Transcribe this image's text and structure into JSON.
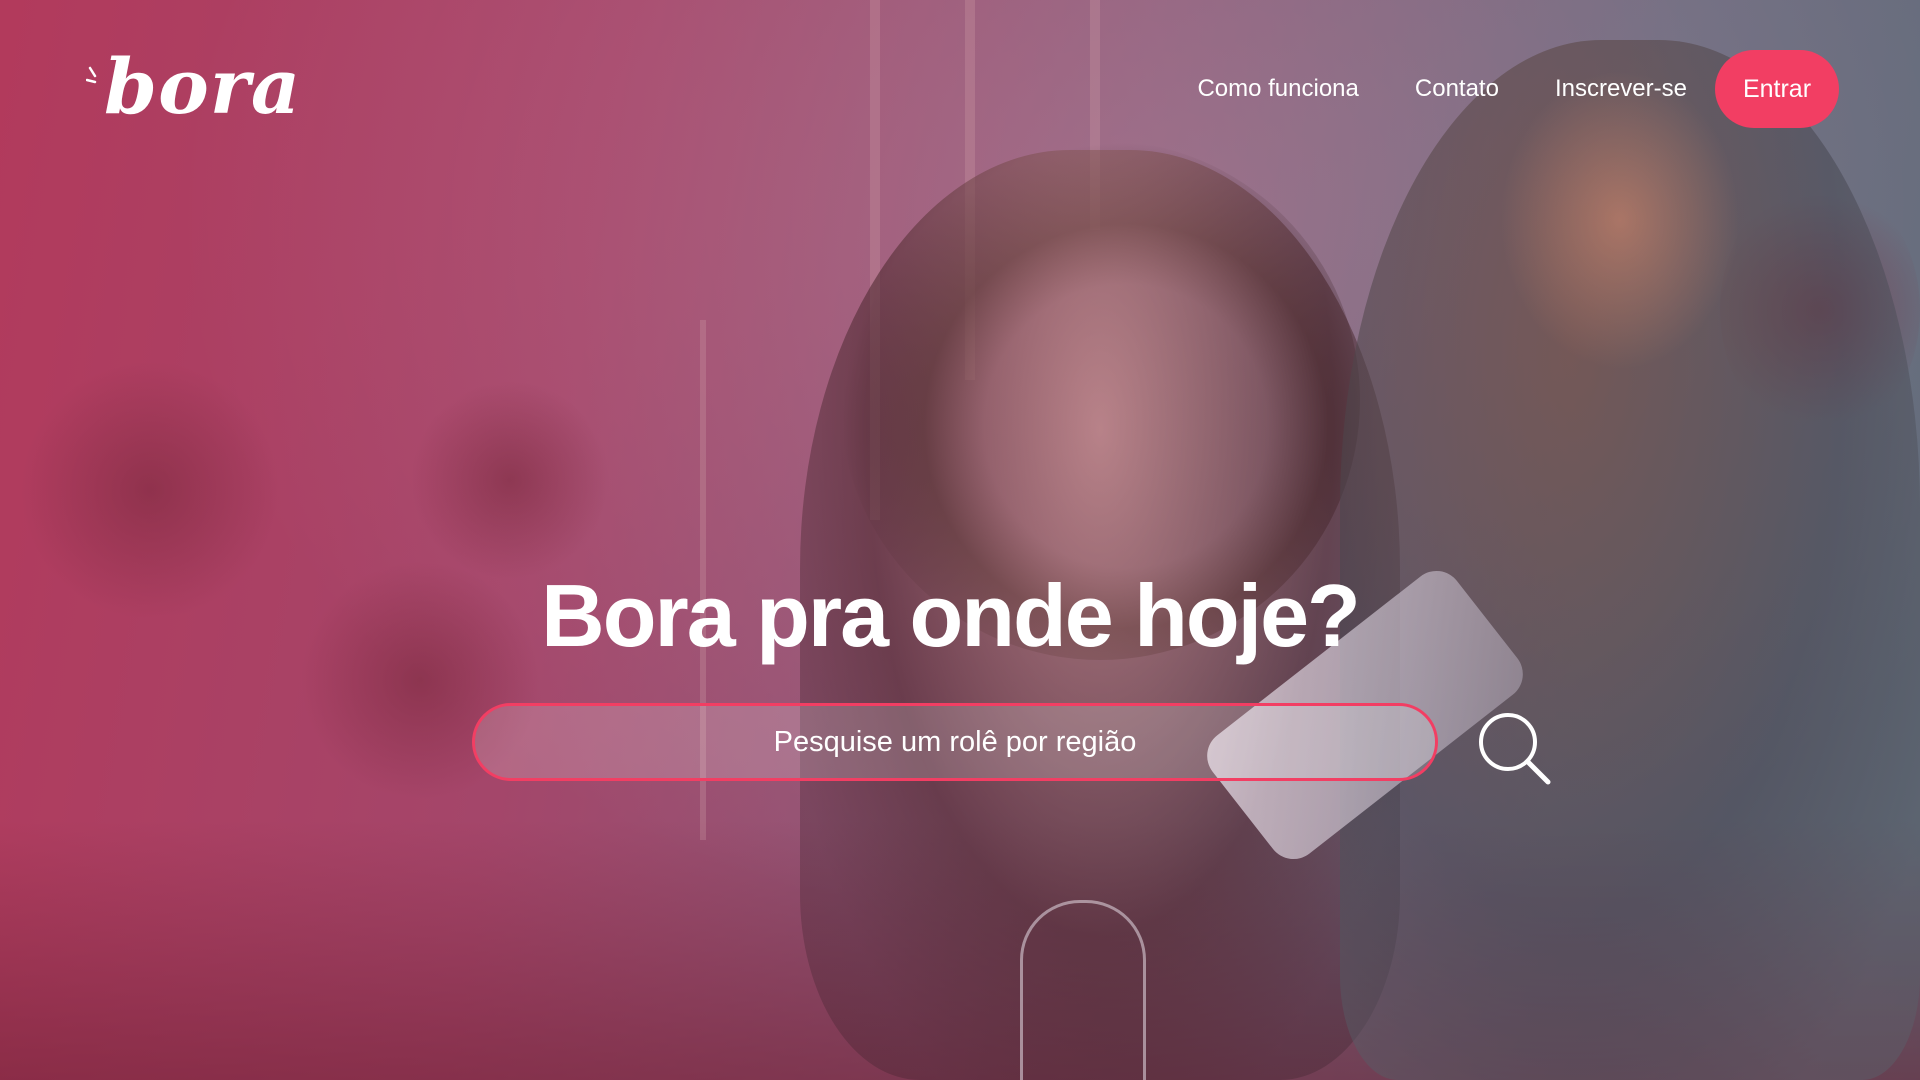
{
  "brand": {
    "logo_text": "bora",
    "accent_color": "#f23e63"
  },
  "nav": {
    "items": [
      {
        "label": "Como funciona"
      },
      {
        "label": "Contato"
      },
      {
        "label": "Inscrever-se"
      }
    ],
    "login_label": "Entrar"
  },
  "hero": {
    "headline": "Bora pra onde hoje?",
    "search": {
      "placeholder": "Pesquise um rolê por região",
      "value": ""
    },
    "search_icon": "search-icon"
  }
}
